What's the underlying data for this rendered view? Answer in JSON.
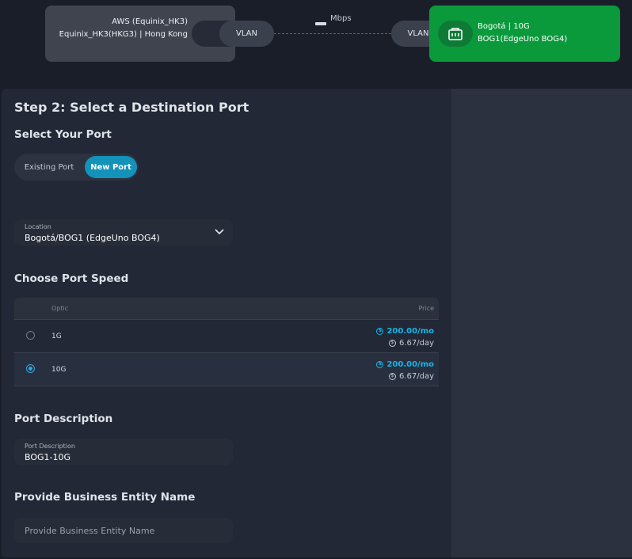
{
  "connection": {
    "source": {
      "line1": "AWS (Equinix_HK3)",
      "line2": "Equinix_HK3(HKG3) | Hong Kong"
    },
    "vlan_left": "VLAN",
    "vlan_right": "VLAN",
    "bandwidth_unit": "Mbps",
    "destination": {
      "line1": "Bogotá | 10G",
      "line2": "BOG1(EdgeUno BOG4)",
      "icon": "building-icon"
    },
    "colors": {
      "destination_card": "#0a9a3c",
      "source_card": "#3f444f"
    }
  },
  "step_title": "Step 2: Select a Destination Port",
  "select_port": {
    "heading": "Select Your Port",
    "existing_label": "Existing Port",
    "new_label": "New Port",
    "selected": "New Port",
    "accent": "#1392ba"
  },
  "location": {
    "label": "Location",
    "value": "Bogotá/BOG1 (EdgeUno BOG4)"
  },
  "port_speed": {
    "heading": "Choose Port Speed",
    "columns": {
      "optic": "Optic",
      "price": "Price"
    },
    "rows": [
      {
        "optic": "1G",
        "monthly": "200.00/mo",
        "daily": "6.67/day",
        "selected": false
      },
      {
        "optic": "10G",
        "monthly": "200.00/mo",
        "daily": "6.67/day",
        "selected": true
      }
    ]
  },
  "port_description": {
    "heading": "Port Description",
    "label": "Port Description",
    "value": "BOG1-10G"
  },
  "business_entity": {
    "heading": "Provide Business Entity Name",
    "placeholder": "Provide Business Entity Name"
  }
}
